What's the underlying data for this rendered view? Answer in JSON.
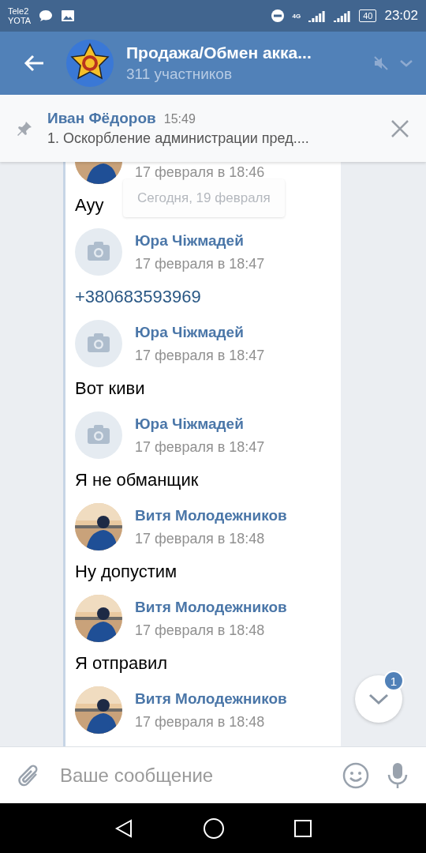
{
  "status_bar": {
    "carriers": [
      "Tele2",
      "YOTA"
    ],
    "network": "4G",
    "battery": "40",
    "time": "23:02"
  },
  "header": {
    "title": "Продажа/Обмен акка...",
    "subtitle": "311 участников",
    "muted": true
  },
  "pinned": {
    "author": "Иван Фёдоров",
    "time": "15:49",
    "text": "1. Оскорбление администрации пред...."
  },
  "date_pill": "Сегодня, 19 февраля",
  "messages": [
    {
      "time": "17 февраля в 18:46",
      "body": {
        "kind": "plain",
        "text": "Ауу"
      }
    },
    {
      "avatar": {
        "kind": "camera"
      },
      "author": "Юра Чіжмадей",
      "time": "17 февраля в 18:47",
      "body": {
        "kind": "link",
        "text": "+380683593969"
      }
    },
    {
      "avatar": {
        "kind": "camera"
      },
      "author": "Юра Чіжмадей",
      "time": "17 февраля в 18:47",
      "body": {
        "kind": "plain",
        "text": "Вот киви"
      }
    },
    {
      "avatar": {
        "kind": "camera"
      },
      "author": "Юра Чіжмадей",
      "time": "17 февраля в 18:47",
      "body": {
        "kind": "plain",
        "text": "Я не обманщик"
      }
    },
    {
      "author": "Витя Молодежников",
      "time": "17 февраля в 18:48",
      "body": {
        "kind": "plain",
        "text": "Ну допустим"
      }
    },
    {
      "author": "Витя Молодежников",
      "time": "17 февраля в 18:48",
      "body": {
        "kind": "plain",
        "text": "Я отправил"
      }
    },
    {
      "author": "Витя Молодежников",
      "time": "17 февраля в 18:48"
    }
  ],
  "scroll_button": {
    "badge": "1"
  },
  "composer": {
    "placeholder": "Ваше сообщение"
  }
}
